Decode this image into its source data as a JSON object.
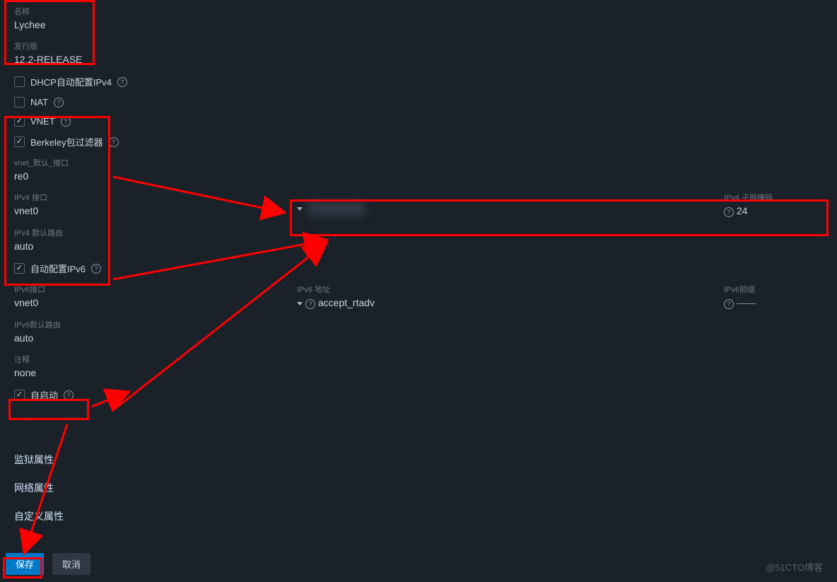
{
  "name": {
    "label": "名称",
    "value": "Lychee"
  },
  "release": {
    "label": "发行版",
    "value": "12.2-RELEASE"
  },
  "checks": {
    "dhcp": {
      "label": "DHCP自动配置IPv4",
      "checked": false,
      "help": true
    },
    "nat": {
      "label": "NAT",
      "checked": false,
      "help": true
    },
    "vnet": {
      "label": "VNET",
      "checked": true,
      "help": true
    },
    "bpf": {
      "label": "Berkeley包过滤器",
      "checked": true,
      "help": true
    },
    "autov6": {
      "label": "自动配置IPv6",
      "checked": true,
      "help": true
    },
    "autostart": {
      "label": "自启动",
      "checked": true,
      "help": true
    }
  },
  "vnet_def_iface": {
    "label": "vnet_默认_接口",
    "value": "re0"
  },
  "ipv4_iface": {
    "label": "IPv4 接口",
    "value": "vnet0"
  },
  "ipv4_gw": {
    "label": "IPv4 默认路由",
    "value": "auto"
  },
  "ipv4_mask": {
    "label": "IPv4 子网掩码",
    "value": "24"
  },
  "ipv6_iface": {
    "label": "IPv6接口",
    "value": "vnet0"
  },
  "ipv6_addr": {
    "label": "IPv6 地址",
    "value": "accept_rtadv"
  },
  "ipv6_prefix": {
    "label": "IPv6前缀",
    "value": "——"
  },
  "ipv6_gw": {
    "label": "IPv6默认路由",
    "value": "auto"
  },
  "notes": {
    "label": "注释",
    "value": "none"
  },
  "sections": {
    "jail": "监狱属性",
    "net": "网络属性",
    "custom": "自定义属性"
  },
  "buttons": {
    "save": "保存",
    "cancel": "取消"
  },
  "watermark": "@51CTO博客"
}
